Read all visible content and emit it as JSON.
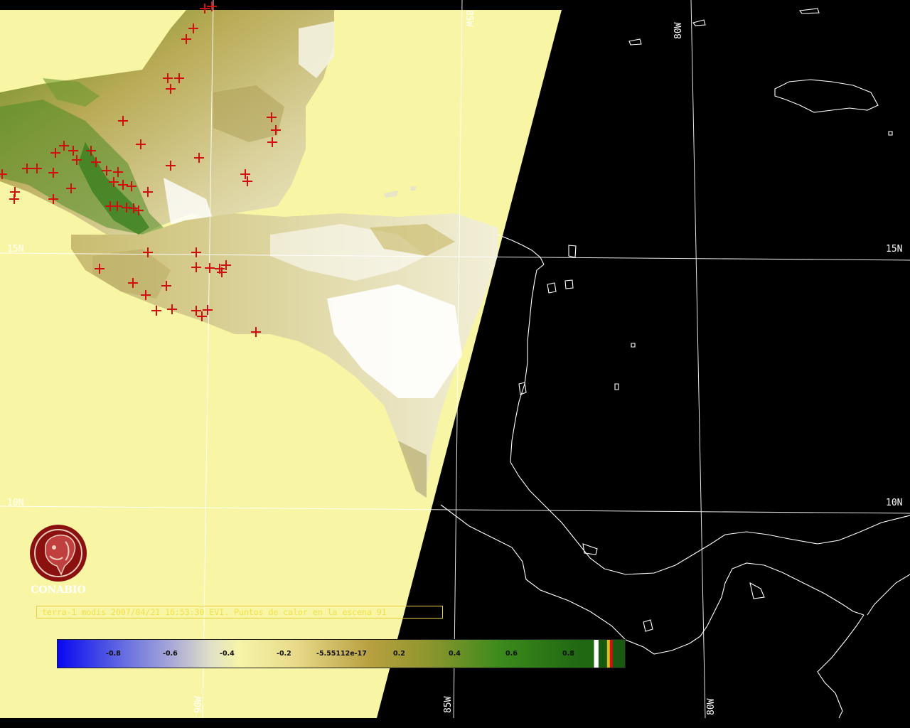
{
  "map": {
    "grid_labels": {
      "lat_15_left": "15N",
      "lat_15_right": "15N",
      "lat_10_left": "10N",
      "lat_10_right": "10N",
      "lon_85_top": "85W",
      "lon_80_top": "80W",
      "lon_90_bottom": "90W",
      "lon_85_bottom": "85W",
      "lon_80_bottom": "80W"
    },
    "colors": {
      "no_data": "#f8f6a4",
      "background": "#000000",
      "coastline": "#ffffff",
      "hotspot": "#d01010",
      "grid": "#ffffff"
    },
    "hotspot_icon": "plus-icon"
  },
  "logo": {
    "name": "CONABIO",
    "icon": "conabio-emblem-icon",
    "color": "#8b1010"
  },
  "caption": {
    "text": "terra-1 modis 2007/04/21 16:53:30 EVI. Puntos de calor en la escena 91"
  },
  "colorbar": {
    "ticks": [
      "-0.8",
      "-0.6",
      "-0.4",
      "-0.2",
      "-5.55112e-17",
      "0.2",
      "0.4",
      "0.6",
      "0.8"
    ]
  }
}
